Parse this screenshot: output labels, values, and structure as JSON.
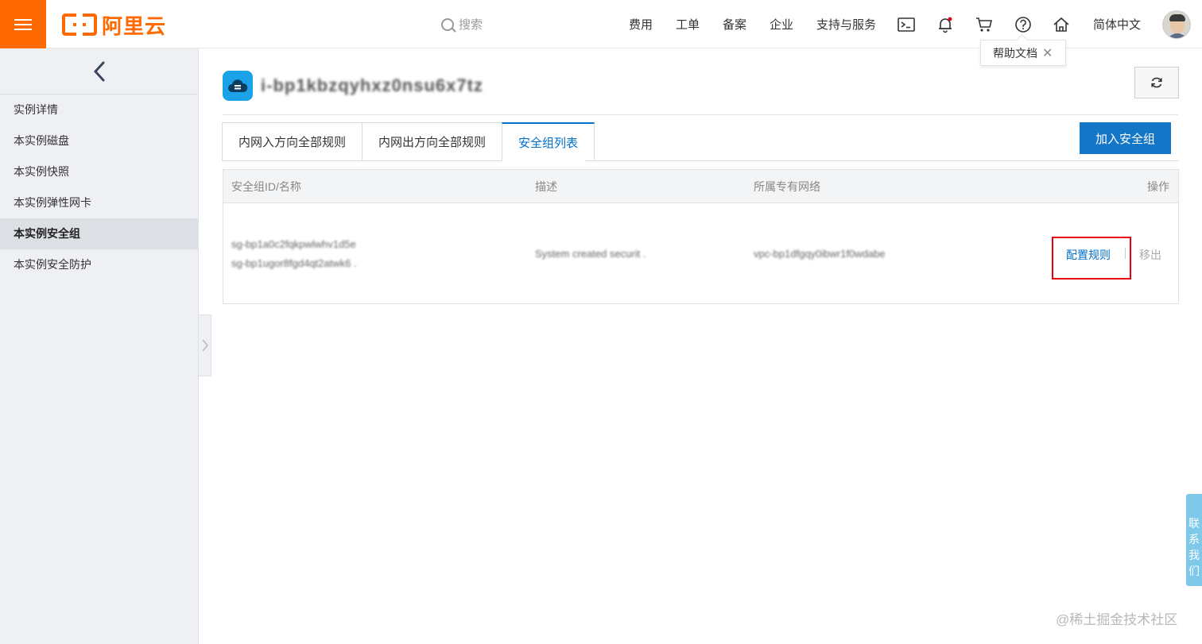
{
  "app": {
    "logo_text": "阿里云"
  },
  "header": {
    "search_placeholder": "搜索",
    "nav_items": [
      "费用",
      "工单",
      "备案",
      "企业",
      "支持与服务"
    ],
    "language": "简体中文",
    "tooltip_text": "帮助文档",
    "tooltip_close": "✕"
  },
  "sidebar": {
    "items": [
      {
        "label": "实例详情"
      },
      {
        "label": "本实例磁盘"
      },
      {
        "label": "本实例快照"
      },
      {
        "label": "本实例弹性网卡"
      },
      {
        "label": "本实例安全组"
      },
      {
        "label": "本实例安全防护"
      }
    ],
    "active_index": 4
  },
  "main": {
    "instance_title": "i-bp1kbzqyhxz0nsu6x7tz",
    "tabs": [
      "内网入方向全部规则",
      "内网出方向全部规则",
      "安全组列表"
    ],
    "active_tab": 2,
    "add_button": "加入安全组",
    "table": {
      "headers": [
        "安全组ID/名称",
        "描述",
        "所属专有网络",
        "操作"
      ],
      "rows": [
        {
          "id_line1": "sg-bp1a0c2fqkpwlwhv1d5e",
          "id_line2": "sg-bp1ugor8fgd4qt2atwk6 .",
          "description": "System created securit .",
          "vpc": "vpc-bp1dfgqy0ibwr1f0wdabe",
          "action_config": "配置规则",
          "action_remove": "移出"
        }
      ]
    }
  },
  "contact_label": [
    "联",
    "系",
    "我",
    "们"
  ],
  "watermark": "@稀土掘金技术社区",
  "colors": {
    "brand": "#ff6a00",
    "primary": "#1476c6",
    "link": "#0070cc",
    "highlight": "#e60012"
  }
}
